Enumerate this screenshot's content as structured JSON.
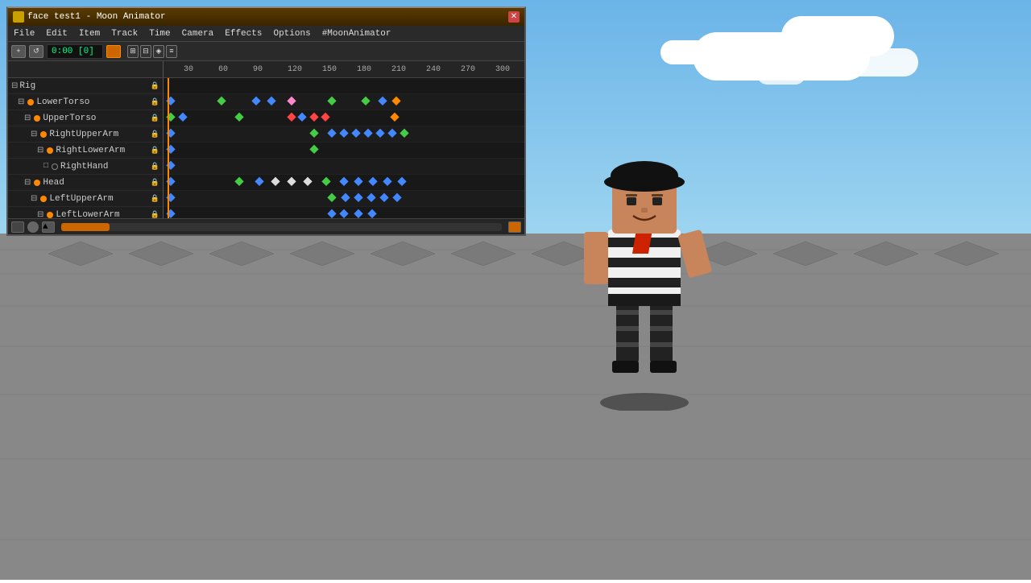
{
  "window": {
    "title": "face test1 - Moon Animator",
    "close_label": "✕"
  },
  "menu": {
    "items": [
      "File",
      "Edit",
      "Item",
      "Track",
      "Time",
      "Camera",
      "Effects",
      "Options",
      "#MoonAnimator"
    ]
  },
  "toolbar": {
    "time_display": "0:00 [0]",
    "add_label": "+",
    "loop_label": "↺"
  },
  "ruler": {
    "ticks": [
      "30",
      "60",
      "90",
      "120",
      "150",
      "180",
      "210",
      "240",
      "270",
      "300"
    ]
  },
  "tracks": [
    {
      "indent": 0,
      "expand": "⊟",
      "name": "Rig",
      "dot": null,
      "lock": true
    },
    {
      "indent": 1,
      "expand": "⊟",
      "name": "LowerTorso",
      "dot": "orange",
      "lock": true
    },
    {
      "indent": 2,
      "expand": "⊟",
      "name": "UpperTorso",
      "dot": "orange",
      "lock": true
    },
    {
      "indent": 3,
      "expand": "⊟",
      "name": "RightUpperArm",
      "dot": "orange",
      "lock": true
    },
    {
      "indent": 4,
      "expand": "⊟",
      "name": "RightLowerArm",
      "dot": "orange",
      "lock": true
    },
    {
      "indent": 5,
      "expand": "□",
      "name": "RightHand",
      "dot": "empty",
      "lock": true
    },
    {
      "indent": 2,
      "expand": "⊟",
      "name": "Head",
      "dot": "orange",
      "lock": true
    },
    {
      "indent": 3,
      "expand": "⊟",
      "name": "LeftUpperArm",
      "dot": "orange",
      "lock": true
    },
    {
      "indent": 4,
      "expand": "⊟",
      "name": "LeftLowerArm",
      "dot": "orange",
      "lock": true
    }
  ]
}
